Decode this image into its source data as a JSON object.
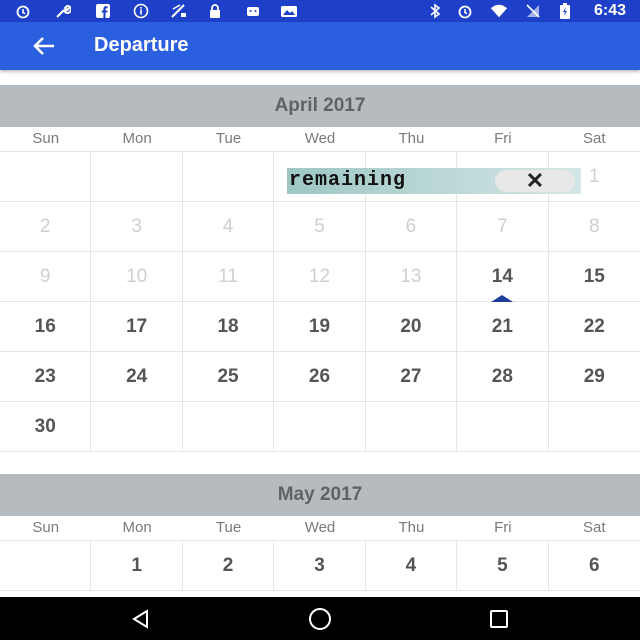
{
  "status_bar": {
    "time": "6:43",
    "left_icons": [
      "alarm-icon",
      "wrench-icon",
      "facebook-icon",
      "info-icon",
      "no-signal-icon",
      "lock-icon",
      "android-icon",
      "photo-icon"
    ],
    "right_icons": [
      "bluetooth-icon",
      "alarm-icon",
      "wifi-icon",
      "no-sim-icon",
      "battery-charging-icon"
    ]
  },
  "app_bar": {
    "title": "Departure"
  },
  "weekdays": [
    "Sun",
    "Mon",
    "Tue",
    "Wed",
    "Thu",
    "Fri",
    "Sat"
  ],
  "months": [
    {
      "title": "April 2017",
      "weeks": [
        [
          "",
          "",
          "",
          "",
          "",
          "",
          "1"
        ],
        [
          "2",
          "3",
          "4",
          "5",
          "6",
          "7",
          "8"
        ],
        [
          "9",
          "10",
          "11",
          "12",
          "13",
          "14",
          "15"
        ],
        [
          "16",
          "17",
          "18",
          "19",
          "20",
          "21",
          "22"
        ],
        [
          "23",
          "24",
          "25",
          "26",
          "27",
          "28",
          "29"
        ],
        [
          "30",
          "",
          "",
          "",
          "",
          "",
          ""
        ]
      ],
      "disabled_through": "13",
      "today": "14"
    },
    {
      "title": "May 2017",
      "weeks": [
        [
          "",
          "1",
          "2",
          "3",
          "4",
          "5",
          "6"
        ]
      ]
    }
  ],
  "ad_banner": {
    "text": "remaining",
    "close_symbol": "✕"
  },
  "colors": {
    "status_bar": "#1e40c8",
    "app_bar": "#2a5fe0",
    "month_header": "#b6bbbf",
    "today_marker": "#1d3d9a"
  }
}
